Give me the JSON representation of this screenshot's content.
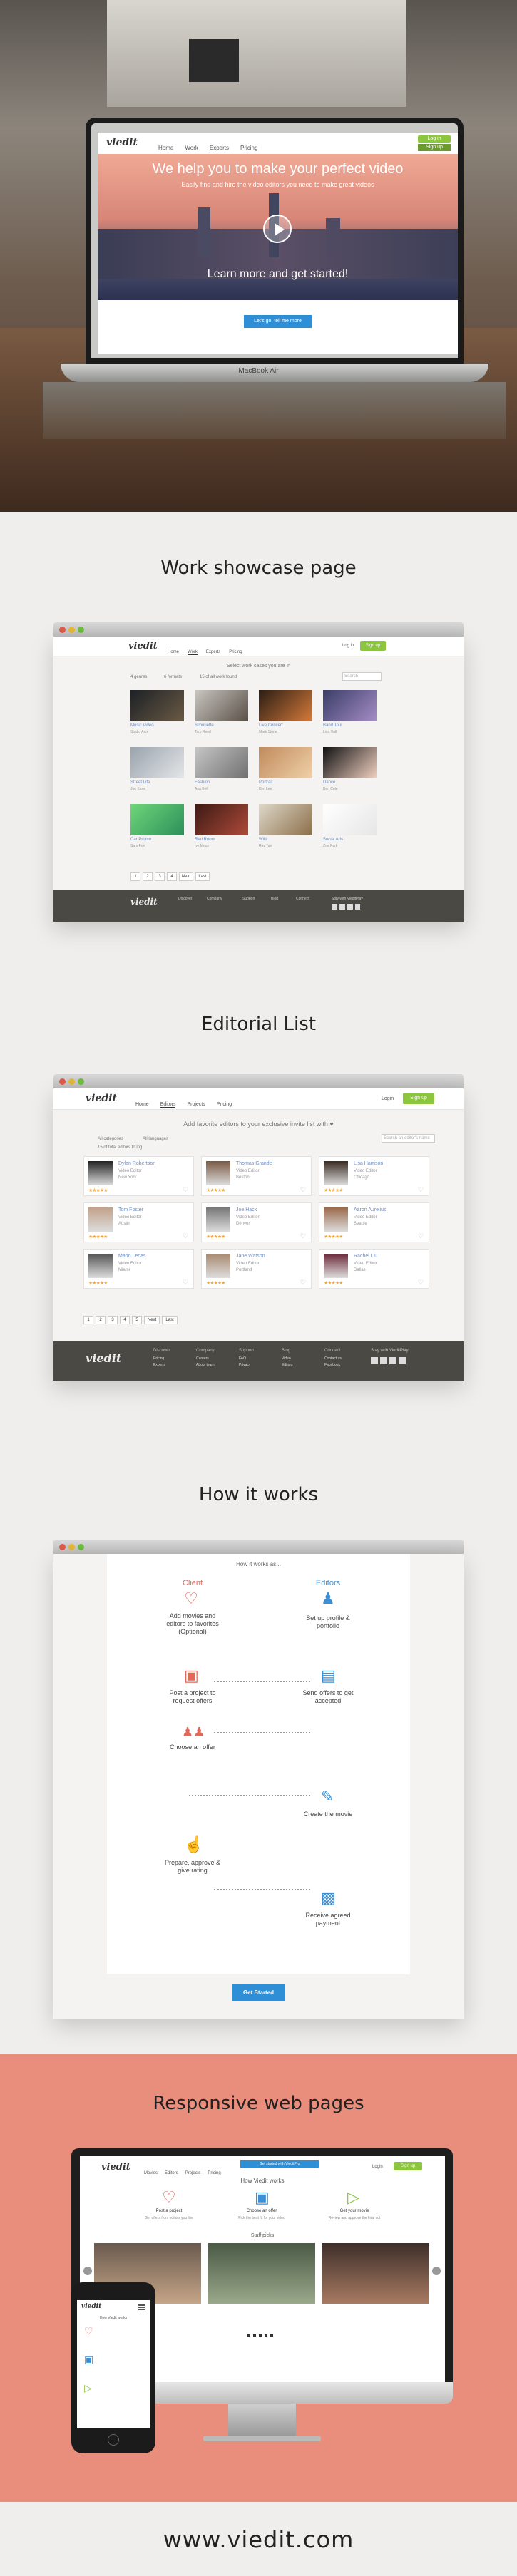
{
  "hero": {
    "nav_logo": "viedit",
    "nav_items": [
      "Home",
      "Work",
      "Experts",
      "Pricing"
    ],
    "login": "Log in",
    "signup": "Sign up",
    "headline": "We help you to make your perfect video",
    "subline": "Easily find and hire the video editors you need to make great videos",
    "cta_text": "Learn more and get started!",
    "button": "Let's go, tell me more",
    "laptop_label": "MacBook Air"
  },
  "showcase": {
    "heading": "Work showcase page",
    "logo": "viedit",
    "nav": [
      "Home",
      "Work",
      "Experts",
      "Pricing"
    ],
    "login": "Log in",
    "signup": "Sign up",
    "intro": "Select work cases you are in",
    "filter1": "4 genres",
    "filter2": "6 formats",
    "filter3": "15 of all work found",
    "search_placeholder": "Search",
    "items": [
      {
        "title": "Music Video",
        "by": "Studio Ann"
      },
      {
        "title": "Silhouette",
        "by": "Tom Reed"
      },
      {
        "title": "Live Concert",
        "by": "Mark Stone"
      },
      {
        "title": "Band Tour",
        "by": "Lisa Hall"
      },
      {
        "title": "Street Life",
        "by": "Joe Kane"
      },
      {
        "title": "Fashion",
        "by": "Ana Bell"
      },
      {
        "title": "Portrait",
        "by": "Kim Lee"
      },
      {
        "title": "Dance",
        "by": "Ben Cole"
      },
      {
        "title": "Car Promo",
        "by": "Sam Fox"
      },
      {
        "title": "Red Room",
        "by": "Ivy Moss"
      },
      {
        "title": "Wild",
        "by": "Ray Tan"
      },
      {
        "title": "Social Ads",
        "by": "Zoe Park"
      }
    ],
    "pages": [
      "1",
      "2",
      "3",
      "4",
      "Next",
      "Last"
    ],
    "footer_logo": "viedit",
    "footer_cols": [
      "Discover",
      "Company",
      "Support",
      "Blog",
      "Connect"
    ],
    "footer_social": "Stay with VieditPlay"
  },
  "editorial": {
    "heading": "Editorial List",
    "logo": "viedit",
    "nav": [
      "Home",
      "Editors",
      "Projects",
      "Pricing"
    ],
    "login": "Login",
    "signup": "Sign up",
    "intro": "Add favorite editors to your exclusive invite list with ♥",
    "filter1": "All categories",
    "filter2": "All languages",
    "filter3": "15 of total editors to log",
    "search_placeholder": "Search an editor's name",
    "editors": [
      {
        "name": "Dylan Robertson",
        "role": "Video Editor",
        "loc": "New York"
      },
      {
        "name": "Thomas Grande",
        "role": "Video Editor",
        "loc": "Boston"
      },
      {
        "name": "Lisa Harrison",
        "role": "Video Editor",
        "loc": "Chicago"
      },
      {
        "name": "Tom Foster",
        "role": "Video Editor",
        "loc": "Austin"
      },
      {
        "name": "Joe Hack",
        "role": "Video Editor",
        "loc": "Denver"
      },
      {
        "name": "Aaron Aurelius",
        "role": "Video Editor",
        "loc": "Seattle"
      },
      {
        "name": "Mario Lenas",
        "role": "Video Editor",
        "loc": "Miami"
      },
      {
        "name": "Jane Watson",
        "role": "Video Editor",
        "loc": "Portland"
      },
      {
        "name": "Rachel Liu",
        "role": "Video Editor",
        "loc": "Dallas"
      }
    ],
    "pages": [
      "1",
      "2",
      "3",
      "4",
      "5",
      "Next",
      "Last"
    ],
    "footer_logo": "viedit",
    "footer_cols": [
      {
        "title": "Discover",
        "links": [
          "Pricing",
          "Experts"
        ]
      },
      {
        "title": "Company",
        "links": [
          "Careers",
          "About team"
        ]
      },
      {
        "title": "Support",
        "links": [
          "FAQ",
          "Privacy"
        ]
      },
      {
        "title": "Blog",
        "links": [
          "Video",
          "Editors"
        ]
      },
      {
        "title": "Connect",
        "links": [
          "Contact us",
          "Facebook"
        ]
      }
    ],
    "footer_social": "Stay with VieditPlay"
  },
  "howitworks": {
    "heading": "How it works",
    "title": "How it works as...",
    "col_client": "Client",
    "col_editor": "Editors",
    "steps_client": [
      "Add movies and editors to favorites (Optional)",
      "Post a project to request offers",
      "Choose an offer",
      "Prepare, approve & give rating"
    ],
    "steps_editor": [
      "Set up profile & portfolio",
      "Send offers to get accepted",
      "Create the movie",
      "Receive agreed payment"
    ],
    "button": "Get Started"
  },
  "responsive": {
    "heading": "Responsive web pages",
    "logo": "viedit",
    "nav": [
      "Movies",
      "Editors",
      "Projects",
      "Pricing"
    ],
    "banner": "Get started with VieditPro",
    "login": "Login",
    "signup": "Sign up",
    "section_title": "How Viedit works",
    "steps": [
      {
        "title": "Post a project",
        "desc": "Get offers from editors you like"
      },
      {
        "title": "Choose an offer",
        "desc": "Pick the best fit for your video"
      },
      {
        "title": "Get your movie",
        "desc": "Review and approve the final cut"
      }
    ],
    "picks_title": "Staff picks",
    "mobile_title": "How Viedit works"
  },
  "footer_url": "www.viedit.com"
}
